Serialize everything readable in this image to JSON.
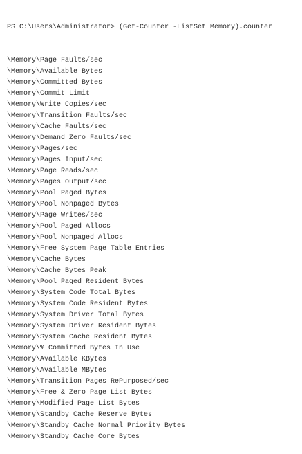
{
  "prompt": "PS C:\\Users\\Administrator> (Get-Counter -ListSet Memory).counter",
  "output": [
    "\\Memory\\Page Faults/sec",
    "\\Memory\\Available Bytes",
    "\\Memory\\Committed Bytes",
    "\\Memory\\Commit Limit",
    "\\Memory\\Write Copies/sec",
    "\\Memory\\Transition Faults/sec",
    "\\Memory\\Cache Faults/sec",
    "\\Memory\\Demand Zero Faults/sec",
    "\\Memory\\Pages/sec",
    "\\Memory\\Pages Input/sec",
    "\\Memory\\Page Reads/sec",
    "\\Memory\\Pages Output/sec",
    "\\Memory\\Pool Paged Bytes",
    "\\Memory\\Pool Nonpaged Bytes",
    "\\Memory\\Page Writes/sec",
    "\\Memory\\Pool Paged Allocs",
    "\\Memory\\Pool Nonpaged Allocs",
    "\\Memory\\Free System Page Table Entries",
    "\\Memory\\Cache Bytes",
    "\\Memory\\Cache Bytes Peak",
    "\\Memory\\Pool Paged Resident Bytes",
    "\\Memory\\System Code Total Bytes",
    "\\Memory\\System Code Resident Bytes",
    "\\Memory\\System Driver Total Bytes",
    "\\Memory\\System Driver Resident Bytes",
    "\\Memory\\System Cache Resident Bytes",
    "\\Memory\\% Committed Bytes In Use",
    "\\Memory\\Available KBytes",
    "\\Memory\\Available MBytes",
    "\\Memory\\Transition Pages RePurposed/sec",
    "\\Memory\\Free & Zero Page List Bytes",
    "\\Memory\\Modified Page List Bytes",
    "\\Memory\\Standby Cache Reserve Bytes",
    "\\Memory\\Standby Cache Normal Priority Bytes",
    "\\Memory\\Standby Cache Core Bytes"
  ]
}
